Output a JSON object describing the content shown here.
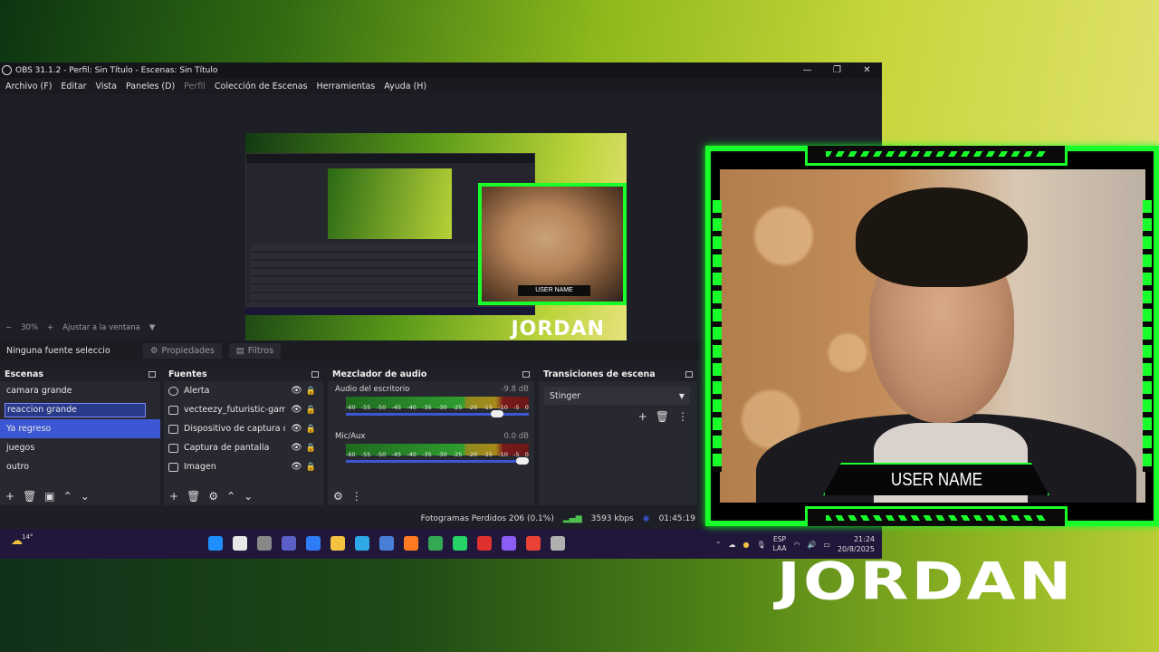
{
  "window": {
    "title": "OBS 31.1.2 - Perfil: Sin Título - Escenas: Sin Título",
    "minimize": "—",
    "maximize": "❐",
    "close": "✕"
  },
  "menu": [
    "Archivo (F)",
    "Editar",
    "Vista",
    "Paneles (D)",
    "Perfil",
    "Colección de Escenas",
    "Herramientas",
    "Ayuda (H)"
  ],
  "preview": {
    "zoom_minus": "−",
    "zoom": "30%",
    "zoom_plus": "+",
    "fit_label": "Ajustar a la ventana",
    "canvas_brand": "JORDAN",
    "canvas_username": "USER NAME"
  },
  "source_toolbar": {
    "no_source": "Ninguna fuente seleccionada",
    "properties": "Propiedades",
    "filters": "Filtros"
  },
  "scenes": {
    "title": "Escenas",
    "items": [
      "camara grande",
      "reaccion grande",
      "Ya regreso",
      "juegos",
      "outro"
    ]
  },
  "sources": {
    "title": "Fuentes",
    "items": [
      "Alerta",
      "vecteezy_futuristic-gaming",
      "Dispositivo de captura de vídeo",
      "Captura de pantalla",
      "Imagen"
    ]
  },
  "mixer": {
    "title": "Mezclador de audio",
    "ticks": [
      "-60",
      "-55",
      "-50",
      "-45",
      "-40",
      "-35",
      "-30",
      "-25",
      "-20",
      "-15",
      "-10",
      "-5",
      "0"
    ],
    "channels": [
      {
        "name": "Audio del escritorio",
        "db": "-9.8 dB",
        "volume": 0.86
      },
      {
        "name": "Mic/Aux",
        "db": "0.0 dB",
        "volume": 1.0
      }
    ]
  },
  "transitions": {
    "title": "Transiciones de escena",
    "selected": "Stinger"
  },
  "status": {
    "dropped": "Fotogramas Perdidos 206 (0.1%)",
    "bitrate": "3593 kbps",
    "time": "01:45:19"
  },
  "taskbar": {
    "temp": "14°",
    "lang_line1": "ESP",
    "lang_line2": "LAA",
    "time": "21:24",
    "date": "20/8/2025",
    "colors": [
      "#1f8fff",
      "#e8e8e8",
      "#888888",
      "#5b5fc7",
      "#2f7df6",
      "#f5c342",
      "#2fa8e8",
      "#4a7fd8",
      "#ff7a20",
      "#34a853",
      "#25d366",
      "#e0312f",
      "#8b5cf6",
      "#ea4335",
      "#b0b0b0"
    ]
  },
  "overlay": {
    "username": "USER NAME",
    "brand": "JORDAN"
  }
}
